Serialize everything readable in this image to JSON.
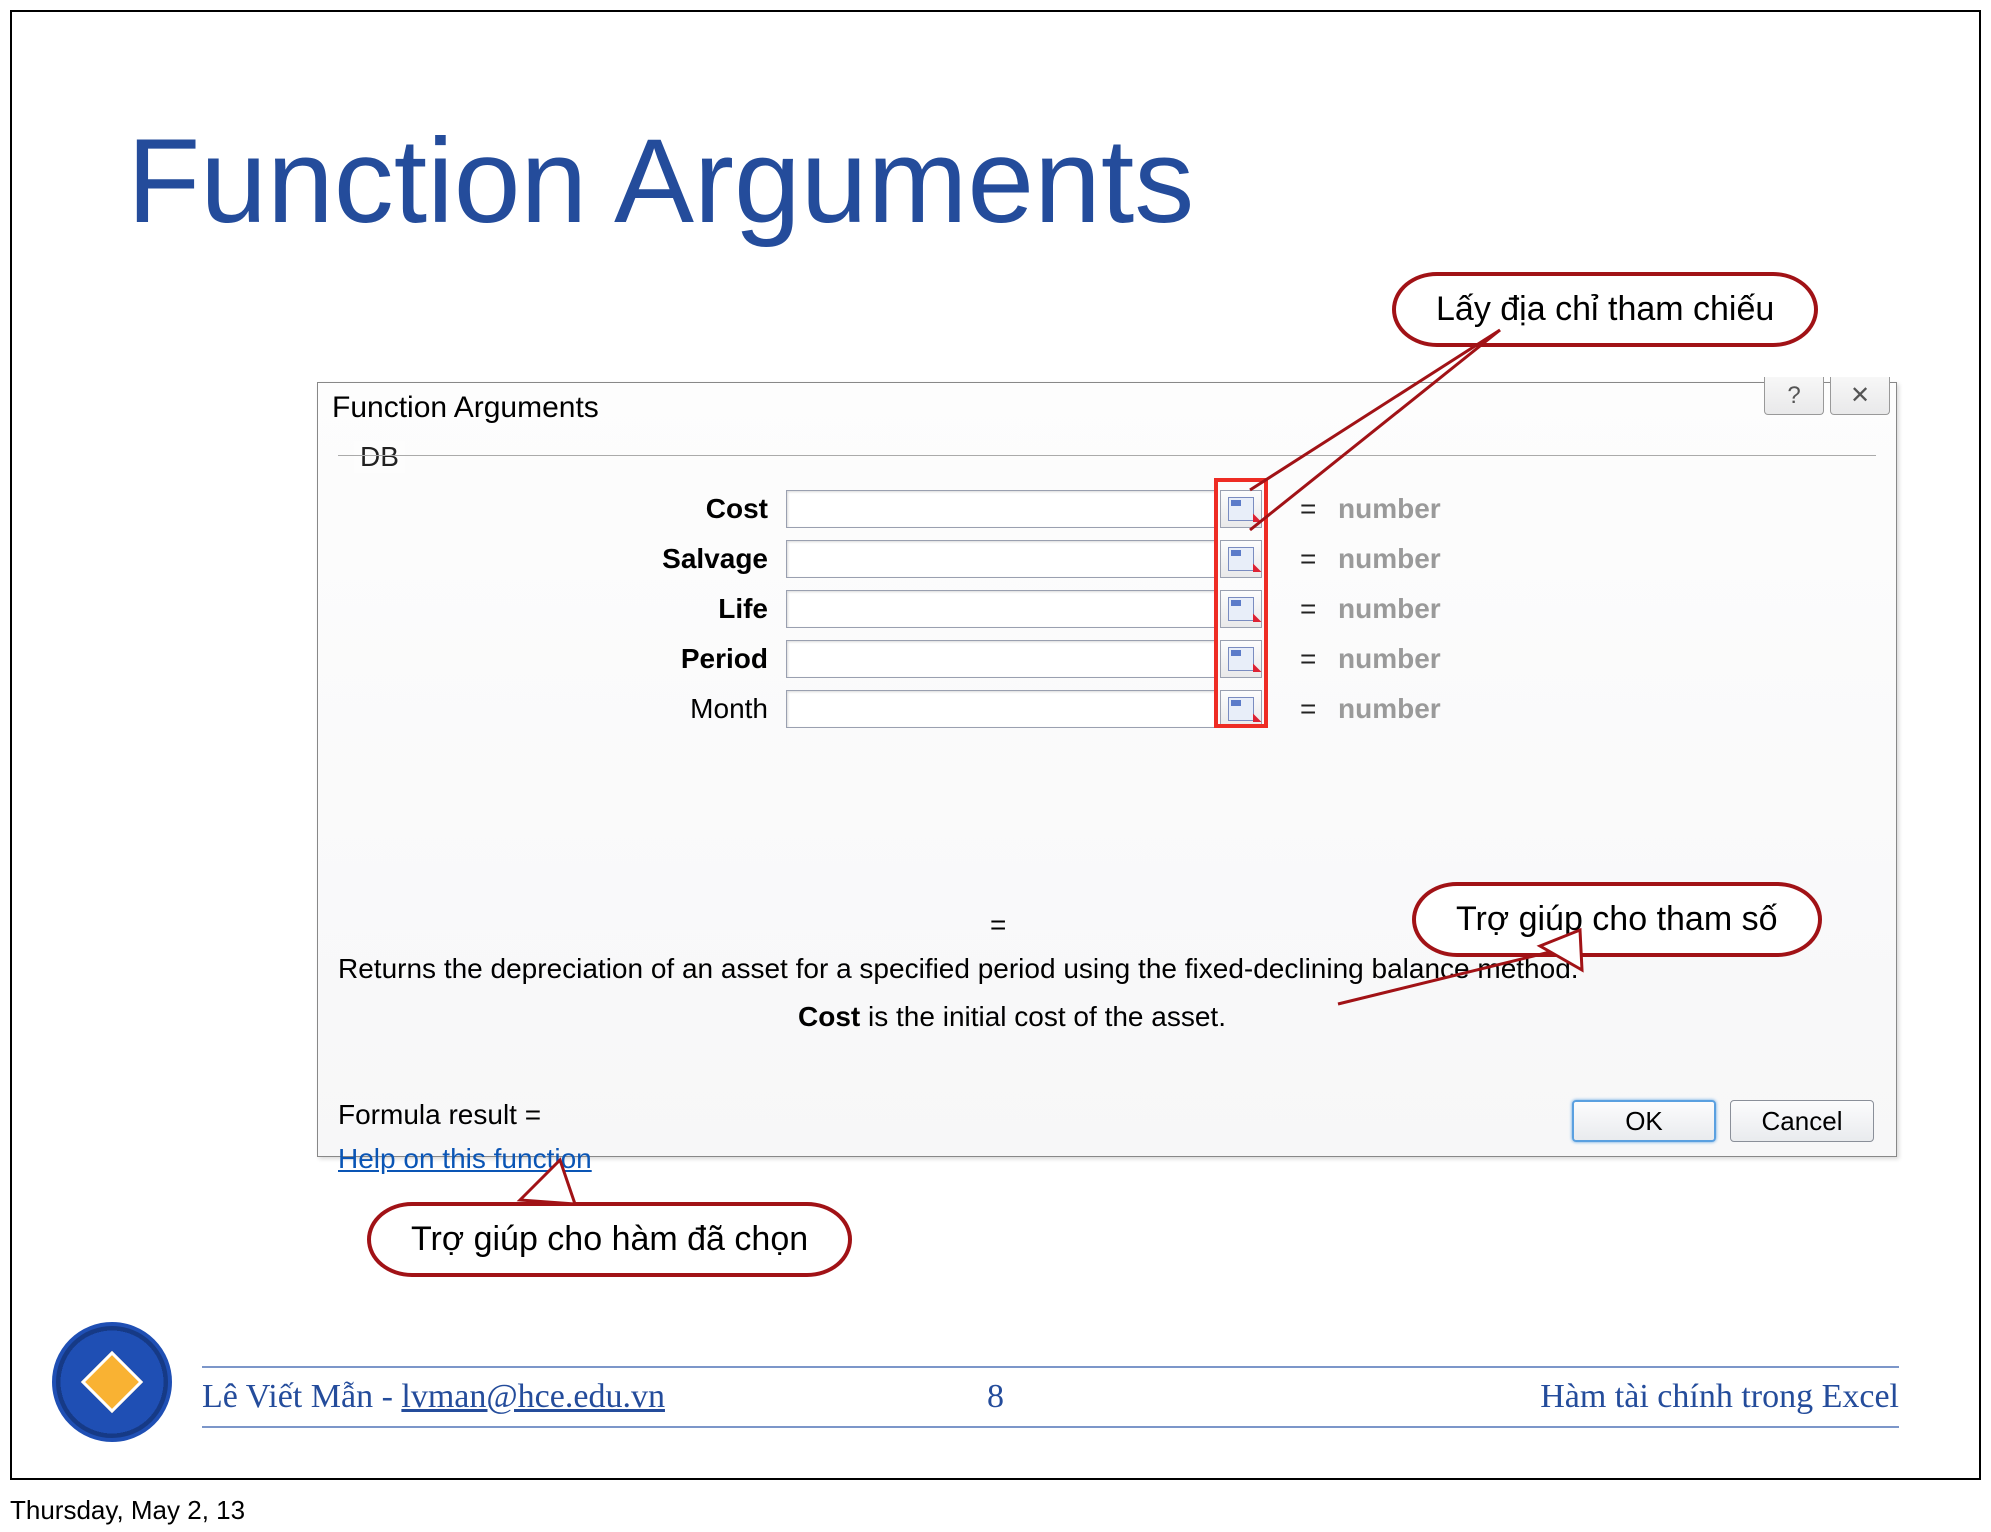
{
  "title": "Function Arguments",
  "callouts": {
    "ref": "Lấy địa chỉ tham chiếu",
    "param_help": "Trợ giúp cho tham số",
    "func_help": "Trợ giúp cho hàm đã chọn"
  },
  "dialog": {
    "title": "Function Arguments",
    "help_glyph": "?",
    "close_glyph": "✕",
    "fieldset": "DB",
    "args": [
      {
        "label": "Cost",
        "bold": true,
        "type": "number"
      },
      {
        "label": "Salvage",
        "bold": true,
        "type": "number"
      },
      {
        "label": "Life",
        "bold": true,
        "type": "number"
      },
      {
        "label": "Period",
        "bold": true,
        "type": "number"
      },
      {
        "label": "Month",
        "bold": false,
        "type": "number"
      }
    ],
    "eq": "=",
    "result_eq": "=",
    "description": "Returns the depreciation of an asset for a specified period using the fixed-declining balance method.",
    "arg_help_label": "Cost",
    "arg_help_text": "  is the initial cost of the asset.",
    "formula_result": "Formula result =",
    "help_link": "Help on this function",
    "ok": "OK",
    "cancel": "Cancel"
  },
  "footer": {
    "author": "Lê Viết Mẫn - ",
    "email": "lvman@hce.edu.vn",
    "page": "8",
    "topic": "Hàm tài chính trong Excel"
  },
  "date": "Thursday, May 2, 13"
}
